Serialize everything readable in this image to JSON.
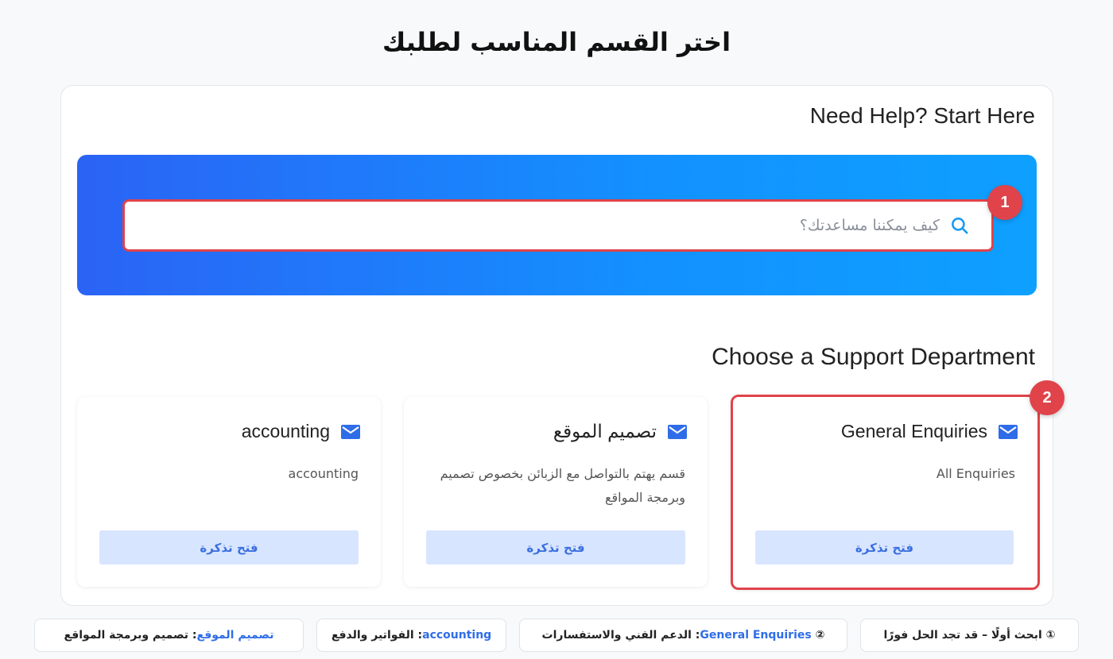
{
  "page": {
    "title": "اختر القسم المناسب لطلبك"
  },
  "help": {
    "title": "Need Help? Start Here",
    "search_placeholder": "كيف يمكننا مساعدتك؟",
    "badge": "1"
  },
  "departments": {
    "title": "Choose a Support Department",
    "badge": "2",
    "items": [
      {
        "name": "General Enquiries",
        "description": "All Enquiries",
        "button": "فتح تذكرة",
        "icon": "mail-icon",
        "highlighted": true
      },
      {
        "name": "تصميم الموقع",
        "description": "قسم يهتم بالتواصل مع الزبائن بخصوص تصميم وبرمجة المواقع",
        "button": "فتح تذكرة",
        "icon": "mail-icon",
        "highlighted": false
      },
      {
        "name": "accounting",
        "description": "accounting",
        "button": "فتح تذكرة",
        "icon": "mail-icon",
        "highlighted": false
      }
    ]
  },
  "legend": [
    {
      "marker": "①",
      "text": "ابحث أولًا – قد تجد الحل فورًا"
    },
    {
      "marker": "②",
      "keyword": "General Enquiries",
      "text": ": الدعم الفني والاستفسارات"
    },
    {
      "keyword": "accounting",
      "text": ": الفواتير والدفع"
    },
    {
      "keyword": "تصميم الموقع",
      "text": ": تصميم وبرمجة المواقع"
    }
  ],
  "colors": {
    "accent": "#2f6de8",
    "highlight": "#e0434a",
    "hero_start": "#2b63f5",
    "hero_end": "#0ea0ff",
    "button_bg": "#d8e5ff"
  }
}
